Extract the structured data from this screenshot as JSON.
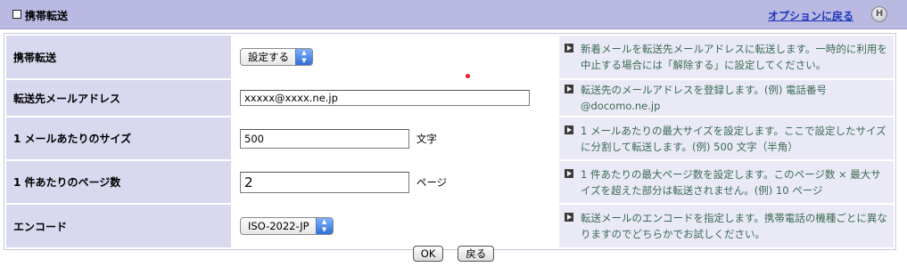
{
  "header": {
    "title": "携帯転送",
    "back_link": "オプションに戻る",
    "help_label": "H"
  },
  "rows": [
    {
      "label": "携帯転送",
      "select_value": "設定する",
      "description": "新着メールを転送先メールアドレスに転送します。一時的に利用を中止する場合には「解除する」に設定してください。"
    },
    {
      "label": "転送先メールアドレス",
      "input_value": "xxxxx@xxxx.ne.jp",
      "description": "転送先のメールアドレスを登録します。(例) 電話番号@docomo.ne.jp"
    },
    {
      "label": "1 メールあたりのサイズ",
      "input_value": "500",
      "unit": "文字",
      "description": "1 メールあたりの最大サイズを設定します。ここで設定したサイズに分割して転送します。(例) 500 文字（半角）"
    },
    {
      "label": "1 件あたりのページ数",
      "input_value": "2",
      "unit": "ページ",
      "description": "1 件あたりの最大ページ数を設定します。このページ数 × 最大サイズを超えた部分は転送されません。(例) 10 ページ"
    },
    {
      "label": "エンコード",
      "select_value": "ISO-2022-JP",
      "description": "転送メールのエンコードを指定します。携帯電話の機種ごとに異なりますのでどちらかでお試しください。"
    }
  ],
  "buttons": {
    "ok_label": "OK",
    "back_label": "戻る"
  }
}
